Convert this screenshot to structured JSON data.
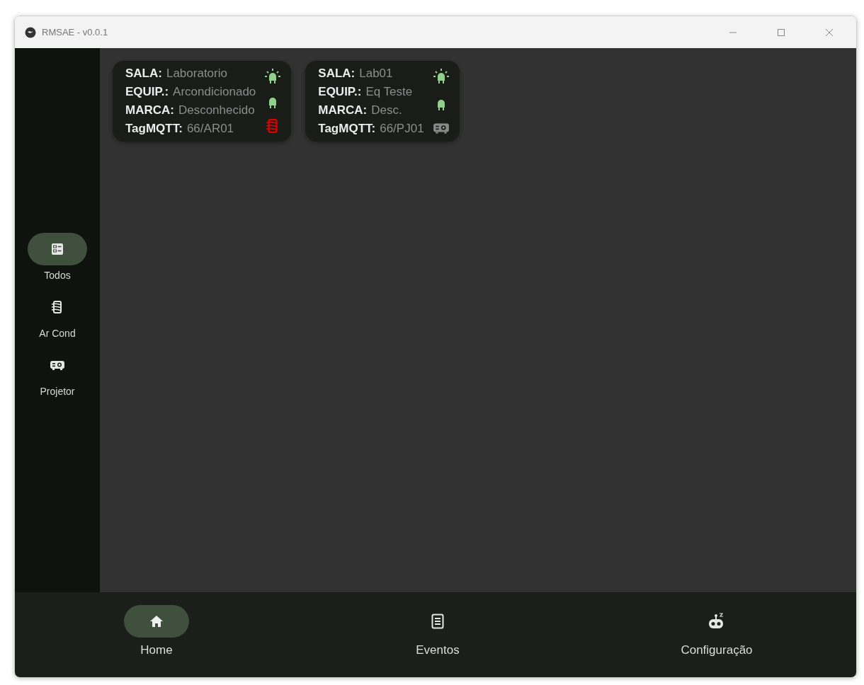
{
  "window": {
    "title": "RMSAE - v0.0.1"
  },
  "sidebar": {
    "items": [
      {
        "kind": "list",
        "label": "Todos",
        "selected": true
      },
      {
        "kind": "aircon",
        "label": "Ar Cond",
        "selected": false
      },
      {
        "kind": "projector",
        "label": "Projetor",
        "selected": false
      }
    ]
  },
  "cards": [
    {
      "fields": [
        {
          "label": "SALA:",
          "value": "Laboratorio"
        },
        {
          "label": "EQUIP.:",
          "value": "Arcondicionado"
        },
        {
          "label": "MARCA:",
          "value": "Desconhecido"
        },
        {
          "label": "TagMQTT:",
          "value": "66/AR01"
        }
      ],
      "indicators": [
        {
          "lit": true
        },
        {
          "lit": false
        }
      ],
      "device": {
        "kind": "aircon",
        "alarm": true
      }
    },
    {
      "fields": [
        {
          "label": "SALA:",
          "value": "Lab01"
        },
        {
          "label": "EQUIP.:",
          "value": "Eq Teste"
        },
        {
          "label": "MARCA:",
          "value": "Desc."
        },
        {
          "label": "TagMQTT:",
          "value": "66/PJ01"
        }
      ],
      "indicators": [
        {
          "lit": true
        },
        {
          "lit": false
        }
      ],
      "device": {
        "kind": "projector",
        "alarm": false
      }
    }
  ],
  "bottom_nav": {
    "items": [
      {
        "kind": "home",
        "label": "Home",
        "selected": true
      },
      {
        "kind": "events",
        "label": "Eventos",
        "selected": false
      },
      {
        "kind": "robot",
        "label": "Configuração",
        "selected": false
      }
    ]
  }
}
